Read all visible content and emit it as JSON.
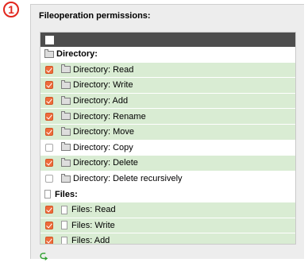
{
  "step": {
    "number": "1"
  },
  "panel": {
    "title": "Fileoperation permissions:"
  },
  "rows": [
    {
      "kind": "group",
      "icon": "folder-icon",
      "label": "Directory:"
    },
    {
      "kind": "item",
      "icon": "folder-icon",
      "label": "Directory: Read",
      "checked": true
    },
    {
      "kind": "item",
      "icon": "folder-icon",
      "label": "Directory: Write",
      "checked": true
    },
    {
      "kind": "item",
      "icon": "folder-icon",
      "label": "Directory: Add",
      "checked": true
    },
    {
      "kind": "item",
      "icon": "folder-icon",
      "label": "Directory: Rename",
      "checked": true
    },
    {
      "kind": "item",
      "icon": "folder-icon",
      "label": "Directory: Move",
      "checked": true
    },
    {
      "kind": "item",
      "icon": "folder-icon",
      "label": "Directory: Copy",
      "checked": false
    },
    {
      "kind": "item",
      "icon": "folder-icon",
      "label": "Directory: Delete",
      "checked": true
    },
    {
      "kind": "item",
      "icon": "folder-icon",
      "label": "Directory: Delete recursively",
      "checked": false
    },
    {
      "kind": "group",
      "icon": "file-icon",
      "label": "Files:"
    },
    {
      "kind": "item",
      "icon": "file-icon",
      "label": "Files: Read",
      "checked": true
    },
    {
      "kind": "item",
      "icon": "file-icon",
      "label": "Files: Write",
      "checked": true
    },
    {
      "kind": "item",
      "icon": "file-icon",
      "label": "Files: Add",
      "checked": true
    }
  ],
  "footer": {
    "icon": "return-arrow-icon",
    "glyph": "⮎"
  }
}
